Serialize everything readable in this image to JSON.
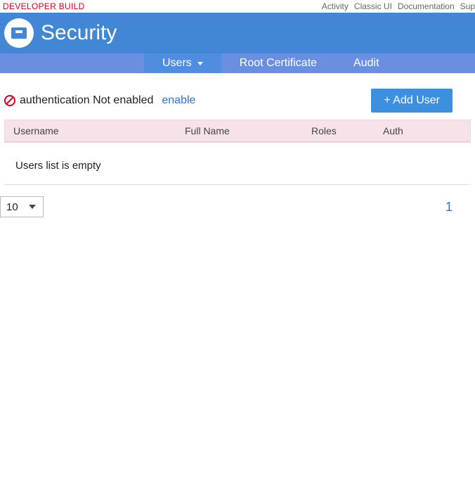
{
  "topbar": {
    "dev_build": "DEVELOPER BUILD",
    "nav": {
      "activity": "Activity",
      "classic_ui": "Classic UI",
      "documentation": "Documentation",
      "support": "Sup"
    }
  },
  "header": {
    "title": "Security"
  },
  "tabs": {
    "users": "Users",
    "root_cert": "Root Certificate",
    "audit": "Audit"
  },
  "auth": {
    "status": "authentication Not enabled",
    "enable_link": "enable",
    "add_user_button": "+ Add User"
  },
  "table": {
    "columns": {
      "username": "Username",
      "fullname": "Full Name",
      "roles": "Roles",
      "auth": "Auth"
    },
    "empty_message": "Users list is empty"
  },
  "pagination": {
    "page_size": "10",
    "current_page": "1"
  }
}
